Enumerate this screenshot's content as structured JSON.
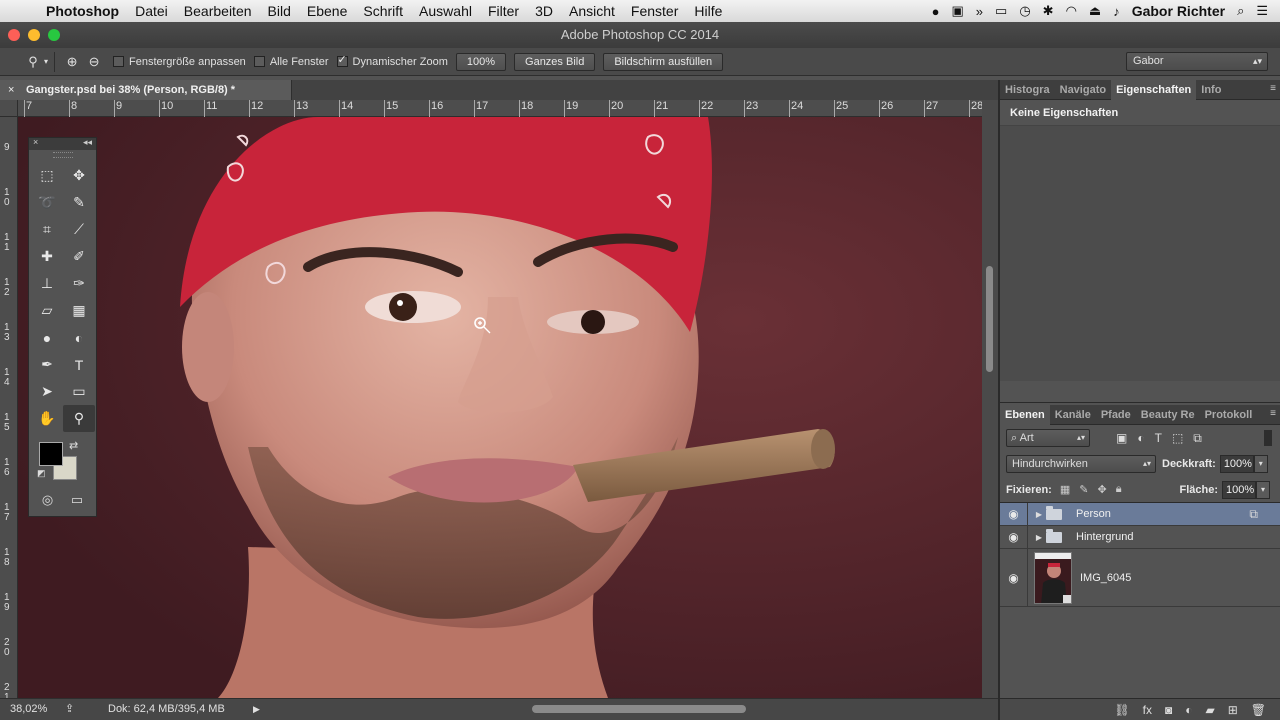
{
  "menubar": {
    "items": [
      "Photoshop",
      "Datei",
      "Bearbeiten",
      "Bild",
      "Ebene",
      "Schrift",
      "Auswahl",
      "Filter",
      "3D",
      "Ansicht",
      "Fenster",
      "Hilfe"
    ],
    "user": "Gabor Richter"
  },
  "window": {
    "title": "Adobe Photoshop CC 2014"
  },
  "options": {
    "resize_windows": "Fenstergröße anpassen",
    "all_windows": "Alle Fenster",
    "scrubby_zoom": "Dynamischer Zoom",
    "zoom_100": "100%",
    "fit_screen": "Ganzes Bild",
    "fill_screen": "Bildschirm ausfüllen",
    "workspace": "Gabor"
  },
  "document": {
    "tab_title": "Gangster.psd bei 38% (Person, RGB/8) *",
    "ruler_h": [
      "7",
      "8",
      "9",
      "10",
      "11",
      "12",
      "13",
      "14",
      "15",
      "16",
      "17",
      "18",
      "19",
      "20",
      "21",
      "22",
      "23",
      "24",
      "25",
      "26",
      "27",
      "28"
    ],
    "ruler_v": [
      "9",
      "10",
      "11",
      "12",
      "13",
      "14",
      "15",
      "16",
      "17",
      "18",
      "19",
      "20",
      "21"
    ]
  },
  "status": {
    "zoom": "38,02%",
    "doc_size": "Dok: 62,4 MB/395,4 MB"
  },
  "properties_panel": {
    "tabs": [
      "Histogra",
      "Navigato",
      "Eigenschaften",
      "Info"
    ],
    "active_tab": "Eigenschaften",
    "message": "Keine Eigenschaften"
  },
  "layers_panel": {
    "tabs": [
      "Ebenen",
      "Kanäle",
      "Pfade",
      "Beauty Re",
      "Protokoll"
    ],
    "active_tab": "Ebenen",
    "kind_filter": "Art",
    "blend_mode": "Hindurchwirken",
    "opacity_label": "Deckkraft:",
    "opacity": "100%",
    "lock_label": "Fixieren:",
    "fill_label": "Fläche:",
    "fill": "100%",
    "layers": [
      {
        "name": "Person",
        "type": "group",
        "selected": true
      },
      {
        "name": "Hintergrund",
        "type": "group",
        "selected": false
      },
      {
        "name": "IMG_6045",
        "type": "smart-object",
        "selected": false
      }
    ]
  },
  "colors": {
    "foreground": "#000000",
    "background": "#d9d7c8",
    "selection": "#6a7b99"
  }
}
